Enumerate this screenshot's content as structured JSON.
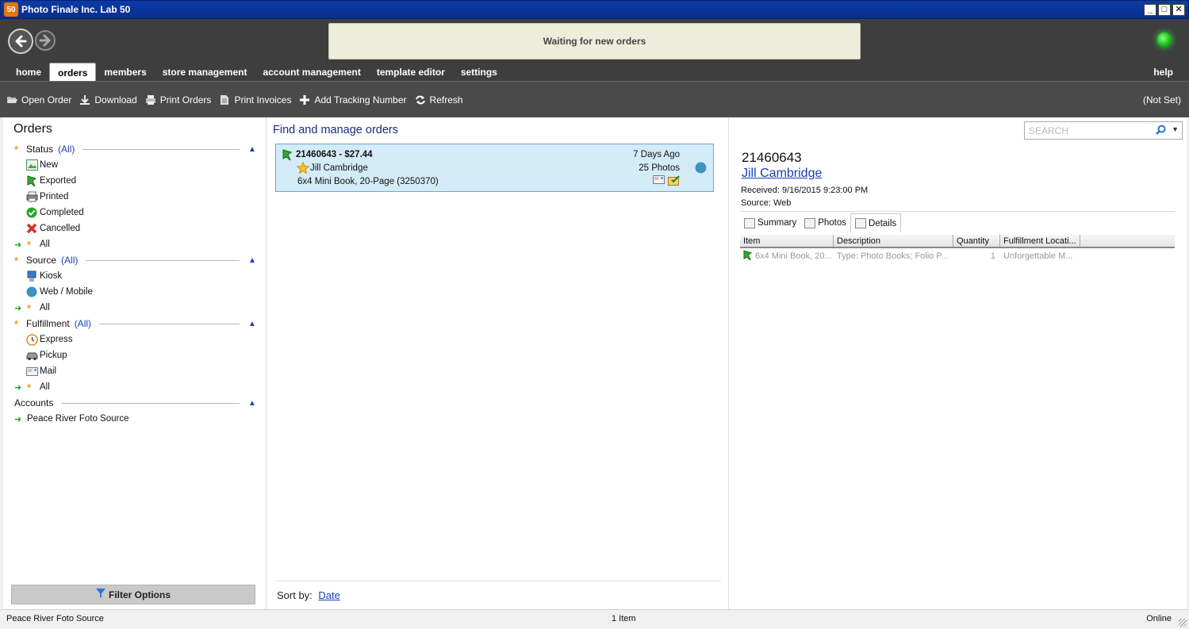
{
  "window": {
    "title": "Photo Finale Inc. Lab 50",
    "logo_text": "50"
  },
  "status_message": "Waiting for new orders",
  "tabs": [
    {
      "label": "home"
    },
    {
      "label": "orders",
      "active": true
    },
    {
      "label": "members"
    },
    {
      "label": "store management"
    },
    {
      "label": "account management"
    },
    {
      "label": "template editor"
    },
    {
      "label": "settings"
    }
  ],
  "help_label": "help",
  "toolbar": {
    "open_order": "Open Order",
    "download": "Download",
    "print_orders": "Print Orders",
    "print_invoices": "Print Invoices",
    "add_tracking": "Add Tracking Number",
    "refresh": "Refresh",
    "store_indicator": "(Not Set)"
  },
  "sidebar": {
    "title": "Orders",
    "status": {
      "label": "Status",
      "all": "(All)",
      "items": [
        "New",
        "Exported",
        "Printed",
        "Completed",
        "Cancelled"
      ],
      "all_row": "All"
    },
    "source": {
      "label": "Source",
      "all": "(All)",
      "items": [
        "Kiosk",
        "Web / Mobile"
      ],
      "all_row": "All"
    },
    "fulfillment": {
      "label": "Fulfillment",
      "all": "(All)",
      "items": [
        "Express",
        "Pickup",
        "Mail"
      ],
      "all_row": "All"
    },
    "accounts": {
      "label": "Accounts",
      "items": [
        "Peace River Foto Source"
      ]
    },
    "filter_button": "Filter Options"
  },
  "orders_list": {
    "title": "Find and manage orders",
    "order": {
      "id_price": "21460643 - $27.44",
      "customer": "Jill Cambridge",
      "product": "6x4 Mini Book, 20-Page (3250370)",
      "age": "7 Days Ago",
      "photos": "25 Photos"
    },
    "sort_label": "Sort by:",
    "sort_value": "Date"
  },
  "detail": {
    "search_placeholder": "SEARCH",
    "order_id": "21460643",
    "customer": "Jill Cambridge",
    "received": "Received: 9/16/2015 9:23:00 PM",
    "source": "Source: Web",
    "tabs": [
      "Summary",
      "Photos",
      "Details"
    ],
    "columns": [
      "Item",
      "Description",
      "Quantity",
      "Fulfillment Locati..."
    ],
    "rows": [
      {
        "item": "6x4 Mini Book, 20...",
        "description": "Type: Photo Books; Folio P...",
        "quantity": "1",
        "location": "Unforgettable M..."
      }
    ]
  },
  "statusbar": {
    "account": "Peace River Foto Source",
    "count": "1 Item",
    "connection": "Online"
  }
}
